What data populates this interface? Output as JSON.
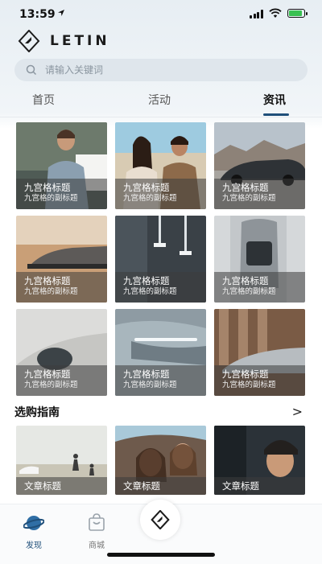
{
  "status_bar": {
    "time": "13:59",
    "location_icon": "location-arrow-icon",
    "battery_color": "#39c152"
  },
  "brand": {
    "name": "LETIN",
    "logo_icon": "letin-logo-icon"
  },
  "search": {
    "placeholder": "请输入关键词",
    "icon": "search-icon"
  },
  "tabs": [
    {
      "label": "首页",
      "active": false
    },
    {
      "label": "活动",
      "active": false
    },
    {
      "label": "资讯",
      "active": true
    }
  ],
  "grid": [
    {
      "title": "九宫格标题",
      "subtitle": "九宫格的副标题",
      "image": "man-by-car-photo"
    },
    {
      "title": "九宫格标题",
      "subtitle": "九宫格的副标题",
      "image": "couple-at-beach-photo"
    },
    {
      "title": "九宫格标题",
      "subtitle": "九宫格的副标题",
      "image": "car-side-mountains-photo"
    },
    {
      "title": "九宫格标题",
      "subtitle": "九宫格的副标题",
      "image": "car-desert-photo"
    },
    {
      "title": "九宫格标题",
      "subtitle": "九宫格的副标题",
      "image": "lamp-interior-photo"
    },
    {
      "title": "九宫格标题",
      "subtitle": "九宫格的副标题",
      "image": "car-top-view-photo"
    },
    {
      "title": "九宫格标题",
      "subtitle": "九宫格的副标题",
      "image": "car-rear-detail-photo"
    },
    {
      "title": "九宫格标题",
      "subtitle": "九宫格的副标题",
      "image": "car-front-headlight-photo"
    },
    {
      "title": "九宫格标题",
      "subtitle": "九宫格的副标题",
      "image": "car-showroom-photo"
    }
  ],
  "guide_section": {
    "title": "选购指南",
    "arrow": ">"
  },
  "articles": [
    {
      "title": "文章标题",
      "image": "people-running-beach-photo"
    },
    {
      "title": "文章标题",
      "image": "women-in-car-photo"
    },
    {
      "title": "文章标题",
      "image": "man-in-car-photo"
    }
  ],
  "bottom_nav": [
    {
      "label": "发现",
      "icon": "discover-planet-icon",
      "active": true
    },
    {
      "label": "商城",
      "icon": "shopping-bag-icon",
      "active": false
    }
  ],
  "accent_color": "#1f4f7a"
}
